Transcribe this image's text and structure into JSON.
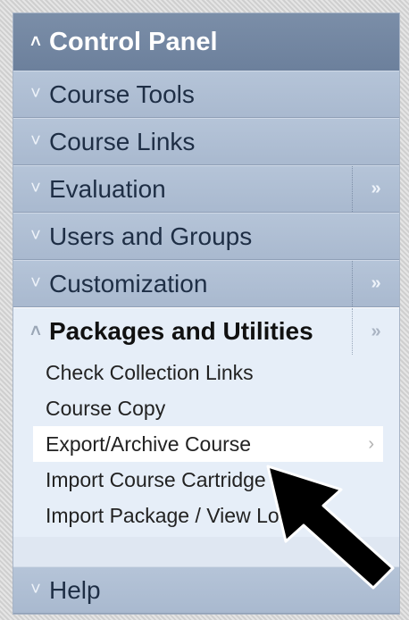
{
  "header": {
    "title": "Control Panel"
  },
  "menu": {
    "items": [
      {
        "label": "Course Tools",
        "expandable": false
      },
      {
        "label": "Course Links",
        "expandable": false
      },
      {
        "label": "Evaluation",
        "expandable": true
      },
      {
        "label": "Users and Groups",
        "expandable": false
      },
      {
        "label": "Customization",
        "expandable": true
      }
    ],
    "open_section": {
      "label": "Packages and Utilities",
      "subitems": [
        "Check Collection Links",
        "Course Copy",
        "Export/Archive Course",
        "Import Course Cartridge",
        "Import Package / View Logs"
      ],
      "active_subitem": "Export/Archive Course"
    },
    "help": {
      "label": "Help"
    }
  },
  "icons": {
    "collapse": "chevron-double-up-icon",
    "expand": "chevron-double-down-icon",
    "flyout": "chevron-double-right-icon",
    "submenu_arrow": "chevron-right-icon",
    "pointer": "black-arrow-pointer"
  },
  "colors": {
    "header_bg": "#6f83a0",
    "row_bg": "#aebdd3",
    "open_bg": "#e6eef8",
    "active_bg": "#ffffff"
  }
}
